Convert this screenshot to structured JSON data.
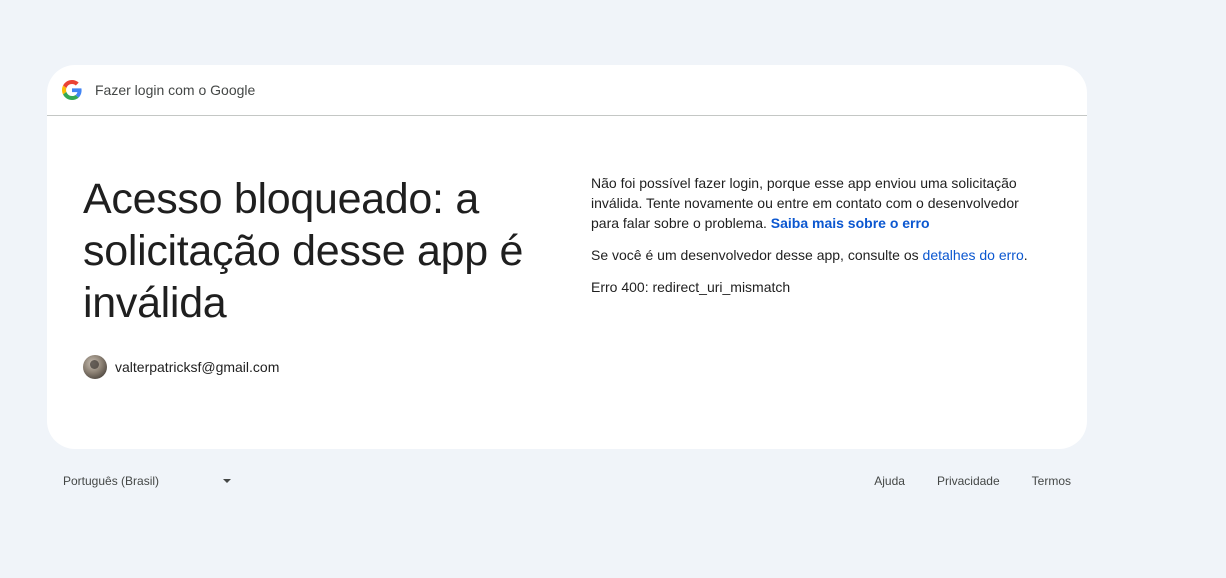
{
  "header": {
    "logo_icon": "google-g-icon",
    "title": "Fazer login com o Google"
  },
  "main": {
    "headline": "Acesso bloqueado: a solicitação desse app é inválida",
    "account": {
      "avatar_icon": "user-avatar",
      "email": "valterpatricksf@gmail.com"
    },
    "message": {
      "text": "Não foi possível fazer login, porque esse app enviou uma solicitação inválida. Tente novamente ou entre em contato com o desenvolvedor para falar sobre o problema.",
      "link": "Saiba mais sobre o erro"
    },
    "developer": {
      "text": "Se você é um desenvolvedor desse app, consulte os",
      "link": "detalhes do erro",
      "suffix": "."
    },
    "error_code": "Erro 400: redirect_uri_mismatch"
  },
  "footer": {
    "language": "Português (Brasil)",
    "links": {
      "help": "Ajuda",
      "privacy": "Privacidade",
      "terms": "Termos"
    }
  },
  "colors": {
    "background": "#f0f4f9",
    "card": "#ffffff",
    "link": "#0b57d0",
    "text": "#1f1f1f"
  }
}
